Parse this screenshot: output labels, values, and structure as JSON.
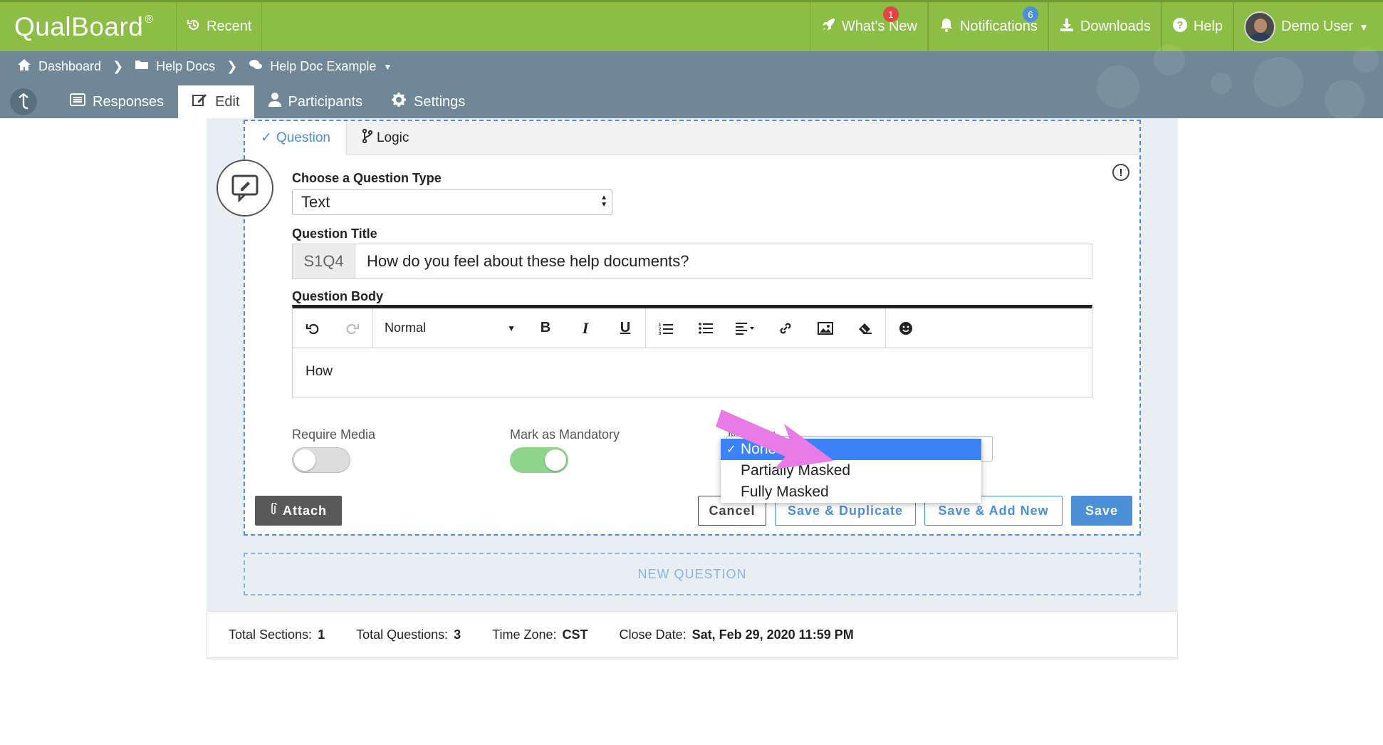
{
  "topbar": {
    "logo": "QualBoard",
    "logo_mark": "®",
    "recent": "Recent",
    "whats_new": "What's New",
    "whats_new_badge": "1",
    "notifications": "Notifications",
    "notifications_badge": "6",
    "downloads": "Downloads",
    "help": "Help",
    "user": "Demo User"
  },
  "breadcrumb": {
    "items": [
      "Dashboard",
      "Help Docs",
      "Help Doc Example"
    ]
  },
  "tabs": {
    "responses": "Responses",
    "edit": "Edit",
    "participants": "Participants",
    "settings": "Settings"
  },
  "card": {
    "tab_question": "Question",
    "tab_logic": "Logic",
    "question_type_label": "Choose a Question Type",
    "question_type_value": "Text",
    "question_title_label": "Question Title",
    "question_prefix": "S1Q4",
    "question_title_value": "How do you feel about these help documents?",
    "question_body_label": "Question Body",
    "format_value": "Normal",
    "body_text": "How",
    "require_media_label": "Require Media",
    "require_media_on": false,
    "mandatory_label": "Mark as Mandatory",
    "mandatory_on": true,
    "masking_label": "Masking",
    "masking_options": [
      "None",
      "Partially Masked",
      "Fully Masked"
    ],
    "masking_selected": "None",
    "attach": "Attach",
    "cancel": "Cancel",
    "save_duplicate": "Save & Duplicate",
    "save_add_new": "Save & Add New",
    "save": "Save"
  },
  "new_question": "NEW QUESTION",
  "footer": {
    "sections_label": "Total Sections:",
    "sections_value": "1",
    "questions_label": "Total Questions:",
    "questions_value": "3",
    "timezone_label": "Time Zone:",
    "timezone_value": "CST",
    "close_label": "Close Date:",
    "close_value": "Sat, Feb 29, 2020 11:59 PM"
  },
  "colors": {
    "topbar": "#8cbd45",
    "subbar": "#6f8797",
    "accent": "#4a8fd8",
    "annotation_arrow": "#e97be6"
  }
}
